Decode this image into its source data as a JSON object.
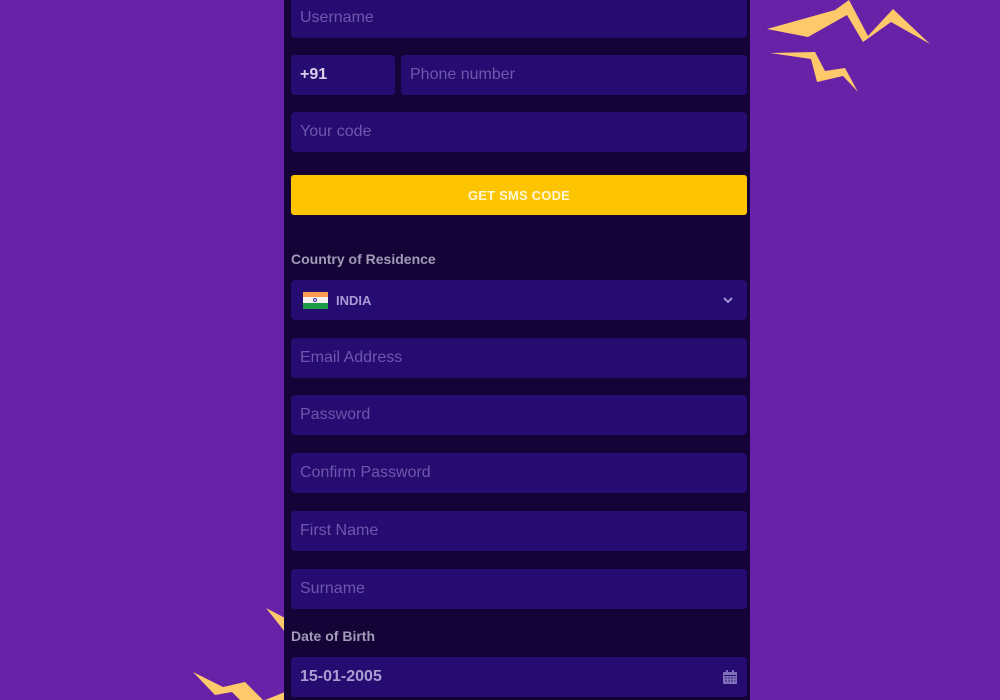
{
  "form": {
    "username": {
      "placeholder": "Username",
      "value": ""
    },
    "phone": {
      "country_code": "+91",
      "placeholder": "Phone number",
      "value": ""
    },
    "code": {
      "placeholder": "Your code",
      "value": ""
    },
    "sms_button_label": "GET SMS CODE",
    "country": {
      "label": "Country of Residence",
      "selected": "INDIA",
      "flag_icon": "india-flag-icon",
      "chevron_icon": "chevron-down-icon"
    },
    "email": {
      "placeholder": "Email Address",
      "value": ""
    },
    "password": {
      "placeholder": "Password",
      "value": ""
    },
    "confirm_password": {
      "placeholder": "Confirm Password",
      "value": ""
    },
    "first_name": {
      "placeholder": "First Name",
      "value": ""
    },
    "surname": {
      "placeholder": "Surname",
      "value": ""
    },
    "date_of_birth": {
      "label": "Date of Birth",
      "value": "15-01-2005",
      "icon": "calendar-icon"
    }
  },
  "colors": {
    "background": "#6722a8",
    "panel": "#140336",
    "input": "#260c71",
    "accent": "#ffc400",
    "decoration": "#fdc96b"
  }
}
